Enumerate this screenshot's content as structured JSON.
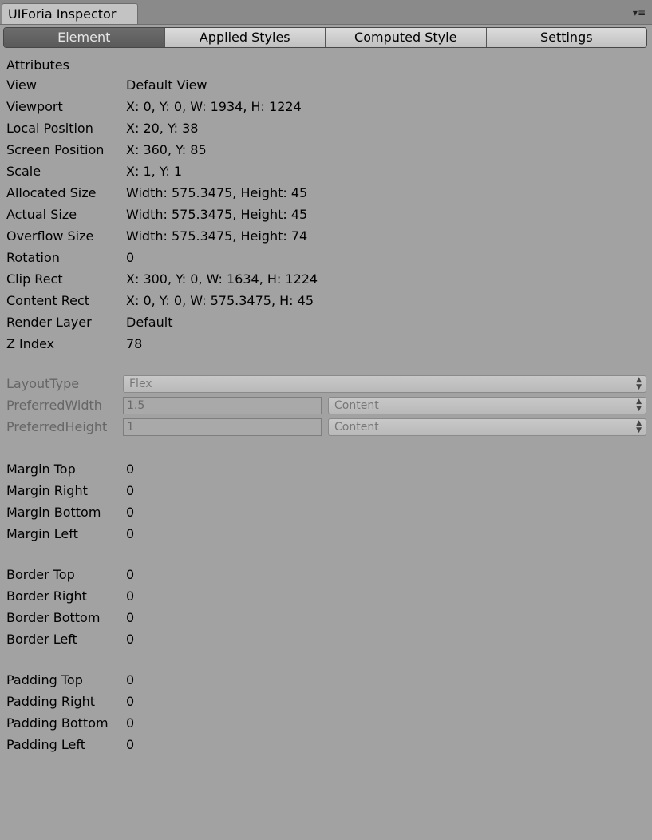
{
  "window": {
    "title": "UIForia Inspector",
    "menu_icon": "▾≡"
  },
  "tabs": [
    {
      "label": "Element",
      "active": true
    },
    {
      "label": "Applied Styles",
      "active": false
    },
    {
      "label": "Computed Style",
      "active": false
    },
    {
      "label": "Settings",
      "active": false
    }
  ],
  "attributes": {
    "heading": "Attributes",
    "rows": [
      {
        "label": "View",
        "value": "Default View"
      },
      {
        "label": "Viewport",
        "value": "X: 0, Y: 0, W: 1934, H: 1224"
      },
      {
        "label": "Local Position",
        "value": "X: 20, Y: 38"
      },
      {
        "label": "Screen Position",
        "value": "X: 360, Y: 85"
      },
      {
        "label": "Scale",
        "value": "X: 1, Y: 1"
      },
      {
        "label": "Allocated Size",
        "value": "Width: 575.3475, Height: 45"
      },
      {
        "label": "Actual Size",
        "value": "Width: 575.3475, Height: 45"
      },
      {
        "label": "Overflow Size",
        "value": "Width: 575.3475, Height: 74"
      },
      {
        "label": "Rotation",
        "value": "0"
      },
      {
        "label": "Clip Rect",
        "value": "X: 300, Y: 0, W: 1634, H: 1224"
      },
      {
        "label": "Content Rect",
        "value": "X: 0, Y: 0, W: 575.3475, H: 45"
      },
      {
        "label": "Render Layer",
        "value": "Default"
      },
      {
        "label": "Z Index",
        "value": "78"
      }
    ]
  },
  "layout": {
    "layout_type": {
      "label": "LayoutType",
      "value": "Flex"
    },
    "preferred_width": {
      "label": "PreferredWidth",
      "value": "1.5",
      "unit": "Content"
    },
    "preferred_height": {
      "label": "PreferredHeight",
      "value": "1",
      "unit": "Content"
    }
  },
  "margin": [
    {
      "label": "Margin Top",
      "value": "0"
    },
    {
      "label": "Margin Right",
      "value": "0"
    },
    {
      "label": "Margin Bottom",
      "value": "0"
    },
    {
      "label": "Margin Left",
      "value": "0"
    }
  ],
  "border": [
    {
      "label": "Border Top",
      "value": "0"
    },
    {
      "label": "Border Right",
      "value": "0"
    },
    {
      "label": "Border Bottom",
      "value": "0"
    },
    {
      "label": "Border Left",
      "value": "0"
    }
  ],
  "padding": [
    {
      "label": "Padding Top",
      "value": "0"
    },
    {
      "label": "Padding Right",
      "value": "0"
    },
    {
      "label": "Padding Bottom",
      "value": "0"
    },
    {
      "label": "Padding Left",
      "value": "0"
    }
  ]
}
